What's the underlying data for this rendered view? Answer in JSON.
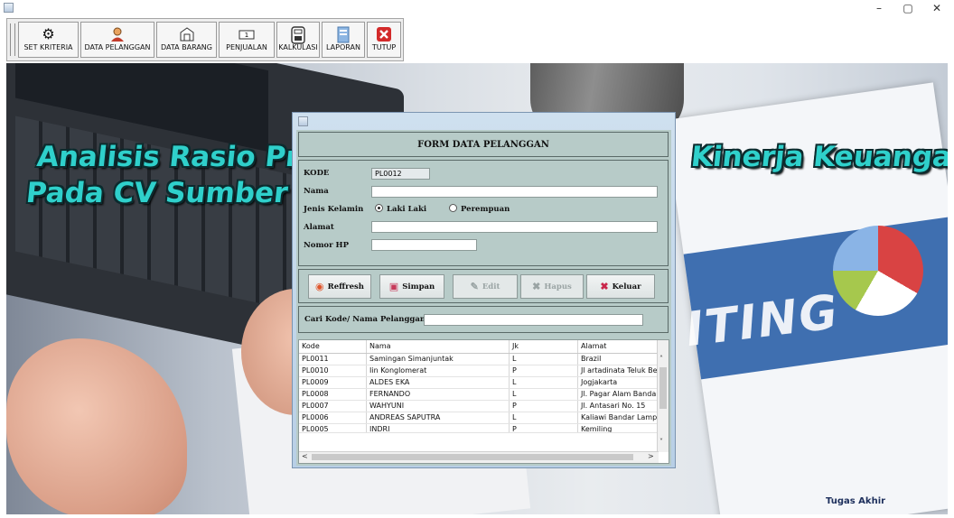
{
  "window": {
    "minimize_glyph": "–",
    "maximize_glyph": "▢",
    "close_glyph": "✕"
  },
  "toolbar": {
    "items": [
      {
        "label": "SET KRITERIA",
        "icon": "gear-icon"
      },
      {
        "label": "DATA PELANGGAN",
        "icon": "customer-icon"
      },
      {
        "label": "DATA BARANG",
        "icon": "box-icon"
      },
      {
        "label": "PENJUALAN",
        "icon": "cash-icon"
      },
      {
        "label": "KALKULASI",
        "icon": "calculator-icon"
      },
      {
        "label": "LAPORAN",
        "icon": "report-icon"
      },
      {
        "label": "TUTUP",
        "icon": "close-icon"
      }
    ]
  },
  "banner": {
    "line1": "Analisis Rasio Profita",
    "line1_right": "Kinerja Keuangan",
    "line2": "Pada CV Sumber Mak",
    "background_word": "ITING",
    "footer": "Tugas Akhir"
  },
  "form": {
    "title": "FORM DATA PELANGGAN",
    "kode_label": "KODE",
    "kode_value": "PL0012",
    "nama_label": "Nama",
    "nama_value": "",
    "jk_label": "Jenis Kelamin",
    "jk_option_male": "Laki Laki",
    "jk_option_female": "Perempuan",
    "jk_selected": "Laki Laki",
    "alamat_label": "Alamat",
    "alamat_value": "",
    "hp_label": "Nomor HP",
    "hp_value": ""
  },
  "actions": {
    "refresh": "Reffresh",
    "save": "Simpan",
    "edit": "Edit",
    "delete": "Hapus",
    "exit": "Keluar"
  },
  "search": {
    "label": "Cari Kode/ Nama Pelanggan",
    "value": ""
  },
  "table": {
    "columns": [
      "Kode",
      "Nama",
      "Jk",
      "Alamat"
    ],
    "rows": [
      [
        "PL0011",
        "Samingan Simanjuntak",
        "L",
        "Brazil"
      ],
      [
        "PL0010",
        "Iin Konglomerat",
        "P",
        "Jl artadinata Teluk Betu"
      ],
      [
        "PL0009",
        "ALDES EKA",
        "L",
        "Jogjakarta"
      ],
      [
        "PL0008",
        "FERNANDO",
        "L",
        "Jl. Pagar Alam Bandarla"
      ],
      [
        "PL0007",
        "WAHYUNI",
        "P",
        "Jl. Antasari No. 15"
      ],
      [
        "PL0006",
        "ANDREAS SAPUTRA",
        "L",
        "Kaliawi Bandar Lampung"
      ],
      [
        "PL0005",
        "INDRI",
        "P",
        "Kemiling"
      ]
    ]
  },
  "colors": {
    "banner_text": "#2fd0cb",
    "form_bg": "#b7cbc8",
    "dialog_frame": "#b8cfe6"
  }
}
